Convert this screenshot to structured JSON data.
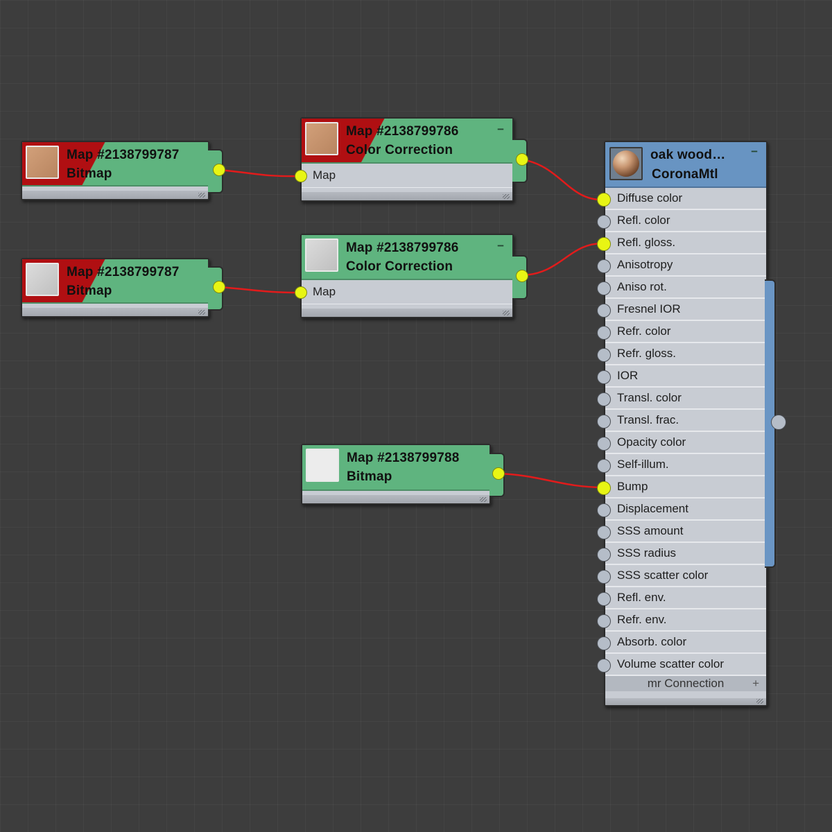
{
  "colors": {
    "background": "#3d3d3d",
    "map_node_header": "#5fb47f",
    "missing_file_red": "#b00f12",
    "material_header": "#6894c2",
    "wire": "#e21b1b",
    "socket_connected": "#e8f514",
    "socket_empty": "#b5bdc8"
  },
  "nodes": {
    "bitmap_a": {
      "title": "Map #2138799787",
      "subtitle": "Bitmap",
      "thumbnail": "wood-texture",
      "missing_file": true
    },
    "color_correction_a": {
      "title": "Map #2138799786",
      "subtitle": "Color Correction",
      "thumbnail": "wood-texture",
      "missing_file": true,
      "collapse": "−",
      "input": "Map"
    },
    "bitmap_b": {
      "title": "Map #2138799787",
      "subtitle": "Bitmap",
      "thumbnail": "grey-texture",
      "missing_file": true
    },
    "color_correction_b": {
      "title": "Map #2138799786",
      "subtitle": "Color Correction",
      "thumbnail": "grey-texture",
      "missing_file": false,
      "collapse": "−",
      "input": "Map"
    },
    "bitmap_c": {
      "title": "Map #2138799788",
      "subtitle": "Bitmap",
      "thumbnail": "white-texture",
      "missing_file": false
    }
  },
  "material": {
    "name": "oak wood…",
    "type": "CoronaMtl",
    "thumbnail": "wood-sphere",
    "collapse": "−",
    "slots": [
      {
        "label": "Diffuse color",
        "connected": true
      },
      {
        "label": "Refl. color",
        "connected": false
      },
      {
        "label": "Refl. gloss.",
        "connected": true
      },
      {
        "label": "Anisotropy",
        "connected": false
      },
      {
        "label": "Aniso rot.",
        "connected": false
      },
      {
        "label": "Fresnel IOR",
        "connected": false
      },
      {
        "label": "Refr. color",
        "connected": false
      },
      {
        "label": "Refr. gloss.",
        "connected": false
      },
      {
        "label": "IOR",
        "connected": false
      },
      {
        "label": "Transl. color",
        "connected": false
      },
      {
        "label": "Transl. frac.",
        "connected": false
      },
      {
        "label": "Opacity color",
        "connected": false
      },
      {
        "label": "Self-illum.",
        "connected": false
      },
      {
        "label": "Bump",
        "connected": true
      },
      {
        "label": "Displacement",
        "connected": false
      },
      {
        "label": "SSS amount",
        "connected": false
      },
      {
        "label": "SSS radius",
        "connected": false
      },
      {
        "label": "SSS scatter color",
        "connected": false
      },
      {
        "label": "Refl. env.",
        "connected": false
      },
      {
        "label": "Refr. env.",
        "connected": false
      },
      {
        "label": "Absorb. color",
        "connected": false
      },
      {
        "label": "Volume scatter color",
        "connected": false
      }
    ],
    "footer": "mr Connection",
    "footer_icon": "+"
  }
}
